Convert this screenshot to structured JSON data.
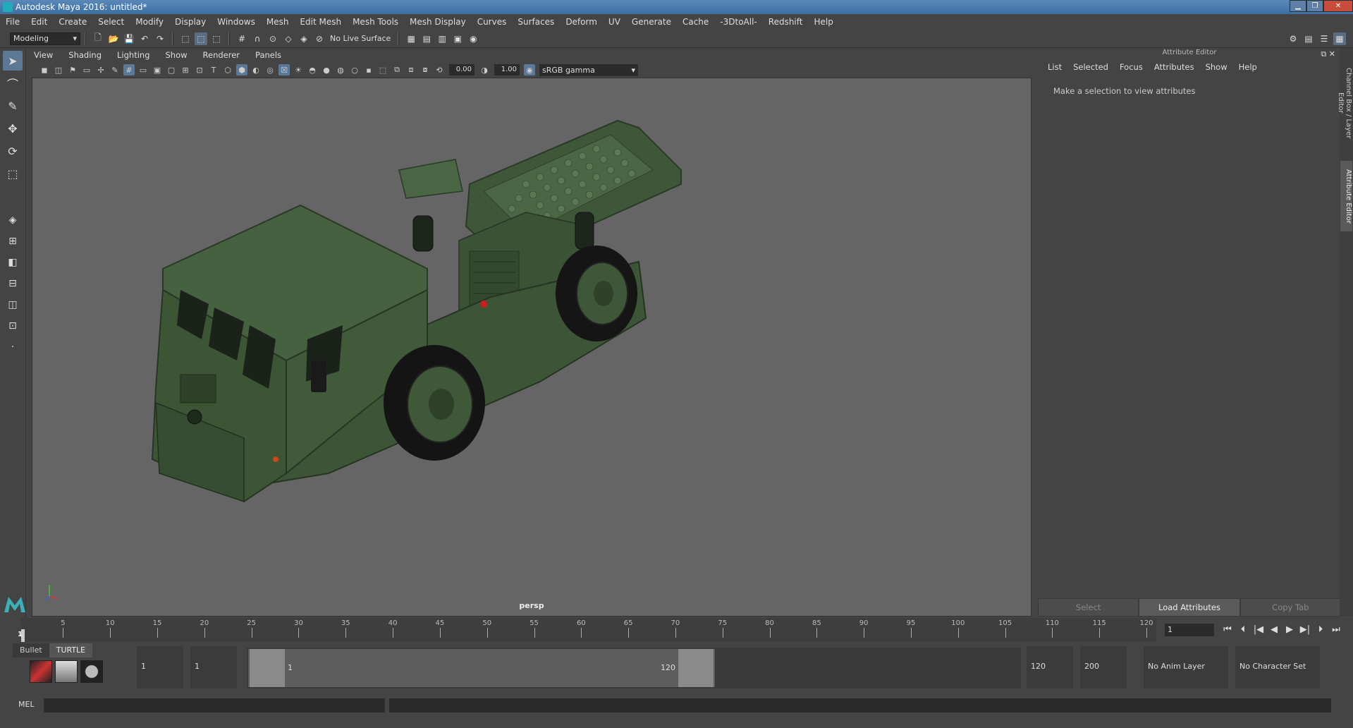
{
  "window": {
    "title": "Autodesk Maya 2016: untitled*",
    "controls": [
      "▁",
      "❐",
      "✕"
    ]
  },
  "menubar": [
    "File",
    "Edit",
    "Create",
    "Select",
    "Modify",
    "Display",
    "Windows",
    "Mesh",
    "Edit Mesh",
    "Mesh Tools",
    "Mesh Display",
    "Curves",
    "Surfaces",
    "Deform",
    "UV",
    "Generate",
    "Cache",
    "-3DtoAll-",
    "Redshift",
    "Help"
  ],
  "statusline": {
    "mode": "Modeling",
    "live_surface": "No Live Surface"
  },
  "panel": {
    "menus": [
      "View",
      "Shading",
      "Lighting",
      "Show",
      "Renderer",
      "Panels"
    ],
    "exposure": "0.00",
    "gamma": "1.00",
    "colorspace": "sRGB gamma",
    "camera": "persp"
  },
  "attribute_editor": {
    "title": "Attribute Editor",
    "menus": [
      "List",
      "Selected",
      "Focus",
      "Attributes",
      "Show",
      "Help"
    ],
    "message": "Make a selection to view attributes",
    "buttons": {
      "select": "Select",
      "load": "Load Attributes",
      "copy": "Copy Tab"
    }
  },
  "side_tabs": {
    "channel_box": "Channel Box / Layer Editor",
    "attribute_editor": "Attribute Editor"
  },
  "timeline": {
    "ticks": [
      5,
      10,
      15,
      20,
      25,
      30,
      35,
      40,
      45,
      50,
      55,
      60,
      65,
      70,
      75,
      80,
      85,
      90,
      95,
      100,
      105,
      110,
      115,
      120
    ],
    "current_frame_label": "1",
    "current_frame_field": "1",
    "max": 120
  },
  "range": {
    "start": "1",
    "playback_start": "1",
    "slider_start": "1",
    "slider_end": "120",
    "playback_end": "120",
    "end": "200",
    "anim_layer": "No Anim Layer",
    "character_set": "No Character Set"
  },
  "shelf": {
    "tabs": [
      "Bullet",
      "TURTLE"
    ]
  },
  "commandline": {
    "label": "MEL"
  },
  "colors": {
    "vehicle": "#3f5a3a",
    "viewport": "#656565",
    "accent": "#5d7895"
  }
}
